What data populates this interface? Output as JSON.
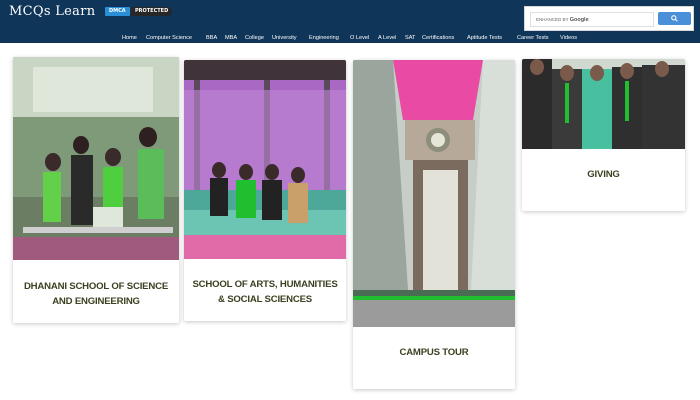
{
  "header": {
    "logo": "MCQs Learn",
    "badge_dmca": "DMCA",
    "badge_protected": "PROTECTED",
    "search_prefix": "ENHANCED BY",
    "search_brand": "Google",
    "search_icon": "search-icon"
  },
  "nav": {
    "items": [
      "Home",
      "Computer Science",
      "BBA",
      "MBA",
      "College",
      "University",
      "Engineering",
      "O Level",
      "A Level",
      "SAT",
      "Certifications",
      "Aptitude Tests",
      "Career Tests",
      "Videos"
    ]
  },
  "cards": [
    {
      "title": "DHANANI SCHOOL OF SCIENCE AND ENGINEERING"
    },
    {
      "title": "SCHOOL OF ARTS, HUMANITIES & SOCIAL SCIENCES"
    },
    {
      "title": "CAMPUS TOUR"
    },
    {
      "title": "GIVING"
    }
  ],
  "colors": {
    "header_bg": "#0f3559",
    "title_text": "#3b4020",
    "search_button": "#4a90d9"
  }
}
